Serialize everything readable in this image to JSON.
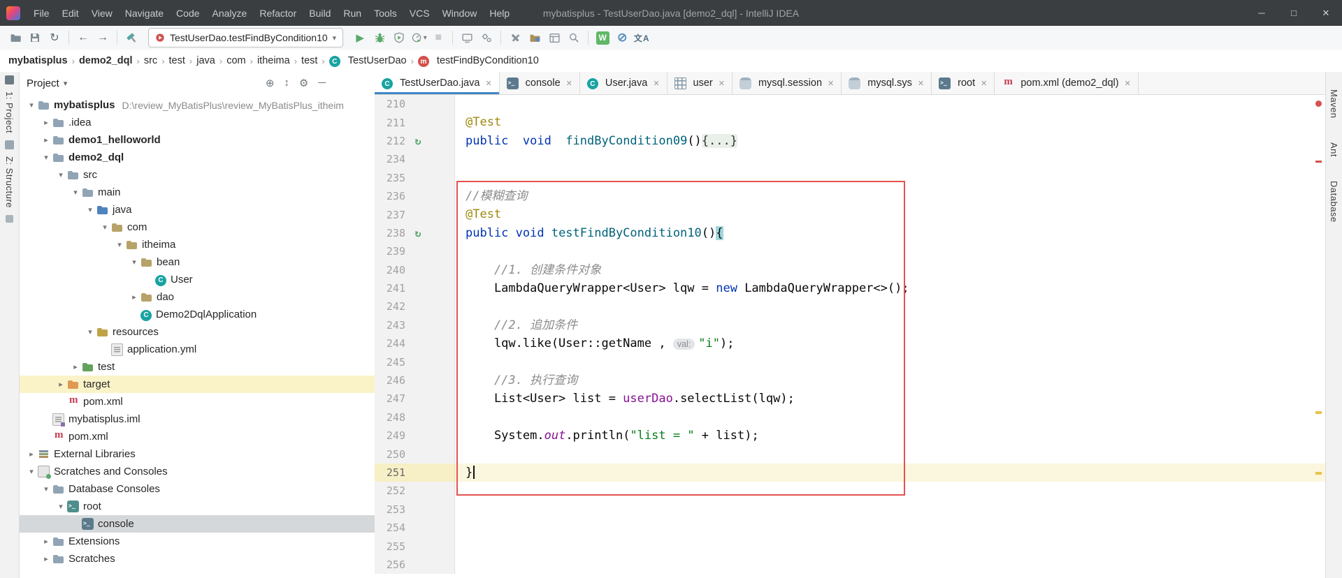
{
  "icons": {
    "minimize": "─",
    "maximize": "□",
    "close": "✕",
    "back": "←",
    "forward": "→",
    "sync": "↻",
    "run": "▶",
    "stop": "■",
    "dropdown": "▾",
    "tab_close": "✕",
    "crumb_sep": "›",
    "tree_expanded": "▾",
    "tree_collapsed": "▸",
    "rerun_gutter": "↻",
    "locate": "⊕",
    "collapse_all": "↕",
    "gear": "⚙",
    "hide": "─",
    "project_caret": "▾",
    "word_badge": "W",
    "power_save": "⊘",
    "translate": "文A"
  },
  "titlebar": {
    "menus": [
      "File",
      "Edit",
      "View",
      "Navigate",
      "Code",
      "Analyze",
      "Refactor",
      "Build",
      "Run",
      "Tools",
      "VCS",
      "Window",
      "Help"
    ],
    "title": "mybatisplus - TestUserDao.java [demo2_dql] - IntelliJ IDEA"
  },
  "toolbar": {
    "run_config": "TestUserDao.testFindByCondition10",
    "buttons": [
      "open",
      "save-all",
      "synchronize",
      "back",
      "forward",
      "build",
      "run-configuration",
      "run",
      "debug",
      "run-with-coverage",
      "profile",
      "stop",
      "attach",
      "plugin-gears",
      "settings",
      "project-structure",
      "layout",
      "search",
      "word-count-plugin",
      "power-save",
      "translate-plugin"
    ]
  },
  "navbar": {
    "crumbs": [
      {
        "label": "mybatisplus",
        "bold": true
      },
      {
        "label": "demo2_dql",
        "bold": true
      },
      {
        "label": "src"
      },
      {
        "label": "test"
      },
      {
        "label": "java"
      },
      {
        "label": "com"
      },
      {
        "label": "itheima"
      },
      {
        "label": "test"
      },
      {
        "label": "TestUserDao",
        "icon": "class"
      },
      {
        "label": "testFindByCondition10",
        "icon": "method"
      }
    ]
  },
  "tabs": [
    {
      "label": "TestUserDao.java",
      "icon": "class",
      "selected": true
    },
    {
      "label": "console",
      "icon": "console"
    },
    {
      "label": "User.java",
      "icon": "class"
    },
    {
      "label": "user",
      "icon": "table"
    },
    {
      "label": "mysql.session",
      "icon": "db"
    },
    {
      "label": "mysql.sys",
      "icon": "db"
    },
    {
      "label": "root",
      "icon": "console"
    },
    {
      "label": "pom.xml (demo2_dql)",
      "icon": "maven"
    }
  ],
  "project": {
    "header": "Project",
    "tree": [
      {
        "label": "mybatisplus",
        "extra": "D:\\review_MyBatisPlus\\review_MyBatisPlus_itheim",
        "depth": 0,
        "icon": "project",
        "arrow": "open",
        "bold": true
      },
      {
        "label": ".idea",
        "depth": 1,
        "icon": "folder",
        "arrow": "closed"
      },
      {
        "label": "demo1_helloworld",
        "depth": 1,
        "icon": "module",
        "arrow": "closed",
        "bold": true
      },
      {
        "label": "demo2_dql",
        "depth": 1,
        "icon": "module",
        "arrow": "open",
        "bold": true
      },
      {
        "label": "src",
        "depth": 2,
        "icon": "folder",
        "arrow": "open"
      },
      {
        "label": "main",
        "depth": 3,
        "icon": "folder",
        "arrow": "open"
      },
      {
        "label": "java",
        "depth": 4,
        "icon": "folder-java",
        "arrow": "open"
      },
      {
        "label": "com",
        "depth": 5,
        "icon": "package",
        "arrow": "open"
      },
      {
        "label": "itheima",
        "depth": 6,
        "icon": "package",
        "arrow": "open"
      },
      {
        "label": "bean",
        "depth": 7,
        "icon": "package",
        "arrow": "open"
      },
      {
        "label": "User",
        "depth": 8,
        "icon": "class",
        "arrow": "none"
      },
      {
        "label": "dao",
        "depth": 7,
        "icon": "package",
        "arrow": "closed"
      },
      {
        "label": "Demo2DqlApplication",
        "depth": 7,
        "icon": "class",
        "arrow": "none"
      },
      {
        "label": "resources",
        "depth": 4,
        "icon": "folder-resources",
        "arrow": "open"
      },
      {
        "label": "application.yml",
        "depth": 5,
        "icon": "yml",
        "arrow": "none"
      },
      {
        "label": "test",
        "depth": 3,
        "icon": "folder-test",
        "arrow": "closed"
      },
      {
        "label": "target",
        "depth": 2,
        "icon": "folder-target",
        "arrow": "closed",
        "highlight": true
      },
      {
        "label": "pom.xml",
        "depth": 2,
        "icon": "maven",
        "arrow": "none"
      },
      {
        "label": "mybatisplus.iml",
        "depth": 1,
        "icon": "iml",
        "arrow": "none"
      },
      {
        "label": "pom.xml",
        "depth": 1,
        "icon": "maven",
        "arrow": "none"
      },
      {
        "label": "External Libraries",
        "depth": 0,
        "icon": "libs",
        "arrow": "closed"
      },
      {
        "label": "Scratches and Consoles",
        "depth": 0,
        "icon": "scratches",
        "arrow": "open"
      },
      {
        "label": "Database Consoles",
        "depth": 1,
        "icon": "folder",
        "arrow": "open"
      },
      {
        "label": "root",
        "depth": 2,
        "icon": "dbconsole",
        "arrow": "open"
      },
      {
        "label": "console",
        "depth": 3,
        "icon": "console",
        "arrow": "none",
        "selected": true
      },
      {
        "label": "Extensions",
        "depth": 1,
        "icon": "folder",
        "arrow": "closed"
      },
      {
        "label": "Scratches",
        "depth": 1,
        "icon": "folder",
        "arrow": "closed"
      }
    ]
  },
  "stripes": {
    "left": [
      "1: Project",
      "Z: Structure"
    ],
    "right": [
      "Maven",
      "Ant",
      "Database"
    ]
  },
  "editor": {
    "lines": [
      {
        "n": 210,
        "segs": []
      },
      {
        "n": 211,
        "segs": [
          {
            "t": "@Test",
            "c": "ann"
          }
        ]
      },
      {
        "n": 212,
        "gutter": "rerun",
        "segs": [
          {
            "t": "public  ",
            "c": "kw"
          },
          {
            "t": "void  ",
            "c": "kw"
          },
          {
            "t": "findByCondition09",
            "c": "mdecl"
          },
          {
            "t": "()",
            "c": "pl"
          },
          {
            "t": "{...}",
            "c": "fold"
          }
        ]
      },
      {
        "n": 234,
        "segs": []
      },
      {
        "n": 235,
        "segs": []
      },
      {
        "n": 236,
        "segs": [
          {
            "t": "//模糊查询",
            "c": "cmt"
          }
        ]
      },
      {
        "n": 237,
        "segs": [
          {
            "t": "@Test",
            "c": "ann"
          }
        ]
      },
      {
        "n": 238,
        "gutter": "rerun",
        "segs": [
          {
            "t": "public void ",
            "c": "kw"
          },
          {
            "t": "testFindByCondition10",
            "c": "mdecl"
          },
          {
            "t": "()",
            "c": "pl"
          },
          {
            "t": "{",
            "c": "brace"
          }
        ]
      },
      {
        "n": 239,
        "segs": []
      },
      {
        "n": 240,
        "segs": [
          {
            "t": "    //1. 创建条件对象",
            "c": "cmt"
          }
        ]
      },
      {
        "n": 241,
        "segs": [
          {
            "t": "    LambdaQueryWrapper<User> lqw = ",
            "c": "pl"
          },
          {
            "t": "new ",
            "c": "kw"
          },
          {
            "t": "LambdaQueryWrapper<>();",
            "c": "pl"
          }
        ]
      },
      {
        "n": 242,
        "segs": []
      },
      {
        "n": 243,
        "segs": [
          {
            "t": "    //2. 追加条件",
            "c": "cmt"
          }
        ]
      },
      {
        "n": 244,
        "segs": [
          {
            "t": "    lqw.like(User::getName , ",
            "c": "pl"
          },
          {
            "t": "val:",
            "c": "hint"
          },
          {
            "t": "\"i\"",
            "c": "str"
          },
          {
            "t": ");",
            "c": "pl"
          }
        ]
      },
      {
        "n": 245,
        "segs": []
      },
      {
        "n": 246,
        "segs": [
          {
            "t": "    //3. 执行查询",
            "c": "cmt"
          }
        ]
      },
      {
        "n": 247,
        "segs": [
          {
            "t": "    List<User> list = ",
            "c": "pl"
          },
          {
            "t": "userDao",
            "c": "fld"
          },
          {
            "t": ".selectList(lqw);",
            "c": "pl"
          }
        ]
      },
      {
        "n": 248,
        "segs": []
      },
      {
        "n": 249,
        "segs": [
          {
            "t": "    System.",
            "c": "pl"
          },
          {
            "t": "out",
            "c": "sfld"
          },
          {
            "t": ".println(",
            "c": "pl"
          },
          {
            "t": "\"list = \"",
            "c": "str"
          },
          {
            "t": " + list);",
            "c": "pl"
          }
        ]
      },
      {
        "n": 250,
        "segs": []
      },
      {
        "n": 251,
        "current": true,
        "segs": [
          {
            "t": "}",
            "c": "pl"
          },
          {
            "c": "caret"
          }
        ]
      },
      {
        "n": 252,
        "segs": []
      },
      {
        "n": 253,
        "segs": []
      },
      {
        "n": 254,
        "segs": []
      },
      {
        "n": 255,
        "segs": []
      },
      {
        "n": 256,
        "segs": []
      }
    ]
  }
}
